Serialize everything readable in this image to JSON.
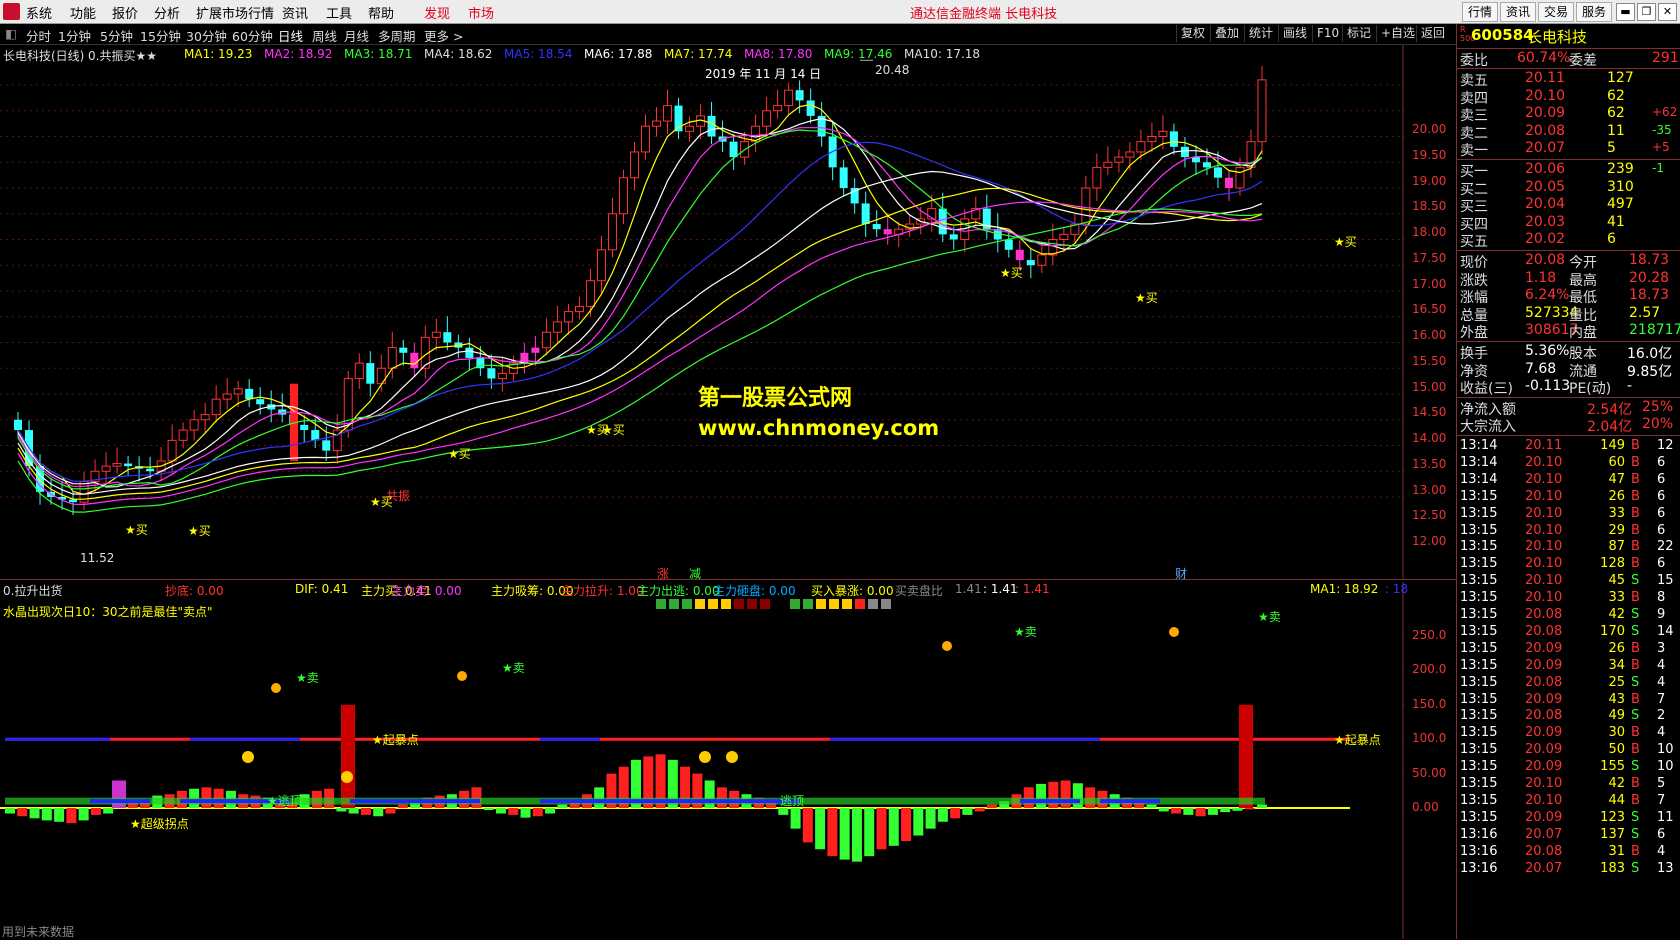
{
  "menu": {
    "items": [
      "系统",
      "功能",
      "报价",
      "分析",
      "扩展市场行情",
      "资讯",
      "工具",
      "帮助"
    ],
    "highlight_items": [
      "发现",
      "市场"
    ],
    "title": "通达信金融终端 长电科技",
    "right_buttons": [
      "行情",
      "资讯",
      "交易",
      "服务"
    ],
    "window_buttons": [
      "▬",
      "❐",
      "✕"
    ]
  },
  "toolbar": {
    "periods": [
      "分时",
      "1分钟",
      "5分钟",
      "15分钟",
      "30分钟",
      "60分钟",
      "日线",
      "周线",
      "月线",
      "多周期",
      "更多 >"
    ],
    "active_period": "日线",
    "right_tools": [
      "复权",
      "叠加",
      "统计",
      "画线",
      "F10",
      "标记",
      "+自选",
      "返回"
    ]
  },
  "main_chart": {
    "stock_title": "长电科技(日线)",
    "formula": "0.共振买★★",
    "ma_labels": [
      {
        "name": "MA1: 19.23",
        "color": "#ffff00"
      },
      {
        "name": "MA2: 18.92",
        "color": "#ff33ff"
      },
      {
        "name": "MA3: 18.71",
        "color": "#33ff33"
      },
      {
        "name": "MA4: 18.62",
        "color": "#dddddd"
      },
      {
        "name": "MA5: 18.54",
        "color": "#3333ff"
      },
      {
        "name": "MA6: 17.88",
        "color": "#ffffff"
      },
      {
        "name": "MA7: 17.74",
        "color": "#ffff00"
      },
      {
        "name": "MA8: 17.80",
        "color": "#ff33ff"
      },
      {
        "name": "MA9: 17.46",
        "color": "#33ff33"
      },
      {
        "name": "MA10: 17.18",
        "color": "#dddddd"
      }
    ],
    "date_label": "2019 年 11 月 14 日",
    "high_label": "20.48",
    "low_label": "11.52",
    "y_ticks": [
      "20.00",
      "19.50",
      "19.00",
      "18.50",
      "18.00",
      "17.50",
      "17.00",
      "16.50",
      "16.00",
      "15.50",
      "15.00",
      "14.50",
      "14.00",
      "13.50",
      "13.00",
      "12.50",
      "12.00"
    ],
    "buy_labels": [
      "★买",
      "★买",
      "★买",
      "★买",
      "★买",
      "★买",
      "★买",
      "★买",
      "★买"
    ],
    "resonance_label": "共振",
    "bottom_markers": [
      "涨",
      "减",
      "财"
    ],
    "watermark_title": "第一股票公式网",
    "watermark_url": "www.chnmoney.com"
  },
  "sub_chart": {
    "formula": "0.拉升出货",
    "indicators": [
      {
        "text": "抄底: 0.00",
        "color": "#ff3333"
      },
      {
        "text": "DIF: 0.41",
        "color": "#ffff00"
      },
      {
        "text": "主力买: 0.41",
        "color": "#ffff00"
      },
      {
        "text": "主力卖: 0.00",
        "color": "#ff33ff"
      },
      {
        "text": "主力吸筹: 0.00",
        "color": "#ffff00"
      },
      {
        "text": "主力拉升: 1.00",
        "color": "#ff3333"
      },
      {
        "text": "主力出逃: 0.00",
        "color": "#33ff33"
      },
      {
        "text": "主力砸盘: 0.00",
        "color": "#00aaff"
      },
      {
        "text": "买入暴涨: 0.00",
        "color": "#ffff00"
      },
      {
        "text": "买卖盘比",
        "color": "#888888"
      },
      {
        "text": "1.41",
        "color": "#888888"
      },
      {
        "text": ": 1.41",
        "color": "#ffffff"
      },
      {
        "text": ": 1.41",
        "color": "#ff3333"
      }
    ],
    "ma_label": "MA1: 18.92",
    "ma_extra": ": 18",
    "note": "水晶出现次日10：30之前是最佳\"卖点\"",
    "y_ticks": [
      "250.0",
      "200.0",
      "150.0",
      "100.0",
      "50.00",
      "0.00"
    ],
    "sell_labels": [
      "★卖",
      "★卖",
      "★卖",
      "★卖"
    ],
    "burst_labels": [
      "★起暴点",
      "★起暴点"
    ],
    "escape_labels": [
      "★逃顶",
      "★逃顶",
      "逃顶"
    ],
    "super_label": "★超级拐点",
    "footer": "用到未来数据"
  },
  "right_panel": {
    "code": "600584",
    "name": "长电科技",
    "weibi": {
      "label1": "委比",
      "v1": "60.74%",
      "label2": "委差",
      "v2": "291"
    },
    "sell": [
      {
        "label": "卖五",
        "price": "20.11",
        "vol": "127",
        "chg": ""
      },
      {
        "label": "卖四",
        "price": "20.10",
        "vol": "62",
        "chg": ""
      },
      {
        "label": "卖三",
        "price": "20.09",
        "vol": "62",
        "chg": "+62"
      },
      {
        "label": "卖二",
        "price": "20.08",
        "vol": "11",
        "chg": "-35"
      },
      {
        "label": "卖一",
        "price": "20.07",
        "vol": "5",
        "chg": "+5"
      }
    ],
    "buy": [
      {
        "label": "买一",
        "price": "20.06",
        "vol": "239",
        "chg": "-1"
      },
      {
        "label": "买二",
        "price": "20.05",
        "vol": "310",
        "chg": ""
      },
      {
        "label": "买三",
        "price": "20.04",
        "vol": "497",
        "chg": ""
      },
      {
        "label": "买四",
        "price": "20.03",
        "vol": "41",
        "chg": ""
      },
      {
        "label": "买五",
        "price": "20.02",
        "vol": "6",
        "chg": ""
      }
    ],
    "quote": [
      {
        "l1": "现价",
        "v1": "20.08",
        "l2": "今开",
        "v2": "18.73"
      },
      {
        "l1": "涨跌",
        "v1": "1.18",
        "l2": "最高",
        "v2": "20.28"
      },
      {
        "l1": "涨幅",
        "v1": "6.24%",
        "l2": "最低",
        "v2": "18.73"
      },
      {
        "l1": "总量",
        "v1": "527334",
        "l2": "量比",
        "v2": "2.57"
      },
      {
        "l1": "外盘",
        "v1": "308617",
        "l2": "内盘",
        "v2": "218717"
      }
    ],
    "fund": [
      {
        "l1": "换手",
        "v1": "5.36%",
        "l2": "股本",
        "v2": "16.0亿"
      },
      {
        "l1": "净资",
        "v1": "7.68",
        "l2": "流通",
        "v2": "9.85亿"
      },
      {
        "l1": "收益(三)",
        "v1": "-0.113",
        "l2": "PE(动)",
        "v2": "-"
      }
    ],
    "flow": [
      {
        "l": "净流入额",
        "v": "2.54亿",
        "p": "25%"
      },
      {
        "l": "大宗流入",
        "v": "2.04亿",
        "p": "20%"
      }
    ],
    "ticks": [
      {
        "t": "13:14",
        "p": "20.11",
        "v": "149",
        "s": "B",
        "n": "12"
      },
      {
        "t": "13:14",
        "p": "20.10",
        "v": "60",
        "s": "B",
        "n": "6"
      },
      {
        "t": "13:14",
        "p": "20.10",
        "v": "47",
        "s": "B",
        "n": "6"
      },
      {
        "t": "13:15",
        "p": "20.10",
        "v": "26",
        "s": "B",
        "n": "6"
      },
      {
        "t": "13:15",
        "p": "20.10",
        "v": "33",
        "s": "B",
        "n": "6"
      },
      {
        "t": "13:15",
        "p": "20.10",
        "v": "29",
        "s": "B",
        "n": "6"
      },
      {
        "t": "13:15",
        "p": "20.10",
        "v": "87",
        "s": "B",
        "n": "22"
      },
      {
        "t": "13:15",
        "p": "20.10",
        "v": "128",
        "s": "B",
        "n": "6"
      },
      {
        "t": "13:15",
        "p": "20.10",
        "v": "45",
        "s": "S",
        "n": "15"
      },
      {
        "t": "13:15",
        "p": "20.10",
        "v": "33",
        "s": "B",
        "n": "8"
      },
      {
        "t": "13:15",
        "p": "20.08",
        "v": "42",
        "s": "S",
        "n": "9"
      },
      {
        "t": "13:15",
        "p": "20.08",
        "v": "170",
        "s": "S",
        "n": "14"
      },
      {
        "t": "13:15",
        "p": "20.09",
        "v": "26",
        "s": "B",
        "n": "3"
      },
      {
        "t": "13:15",
        "p": "20.09",
        "v": "34",
        "s": "B",
        "n": "4"
      },
      {
        "t": "13:15",
        "p": "20.08",
        "v": "25",
        "s": "S",
        "n": "4"
      },
      {
        "t": "13:15",
        "p": "20.09",
        "v": "43",
        "s": "B",
        "n": "7"
      },
      {
        "t": "13:15",
        "p": "20.08",
        "v": "49",
        "s": "S",
        "n": "2"
      },
      {
        "t": "13:15",
        "p": "20.09",
        "v": "30",
        "s": "B",
        "n": "4"
      },
      {
        "t": "13:15",
        "p": "20.09",
        "v": "50",
        "s": "B",
        "n": "10"
      },
      {
        "t": "13:15",
        "p": "20.09",
        "v": "155",
        "s": "S",
        "n": "10"
      },
      {
        "t": "13:15",
        "p": "20.10",
        "v": "42",
        "s": "B",
        "n": "5"
      },
      {
        "t": "13:15",
        "p": "20.10",
        "v": "44",
        "s": "B",
        "n": "7"
      },
      {
        "t": "13:15",
        "p": "20.09",
        "v": "123",
        "s": "S",
        "n": "11"
      },
      {
        "t": "13:16",
        "p": "20.07",
        "v": "137",
        "s": "S",
        "n": "6"
      },
      {
        "t": "13:16",
        "p": "20.08",
        "v": "31",
        "s": "B",
        "n": "4"
      },
      {
        "t": "13:16",
        "p": "20.07",
        "v": "183",
        "s": "S",
        "n": "13"
      }
    ]
  }
}
